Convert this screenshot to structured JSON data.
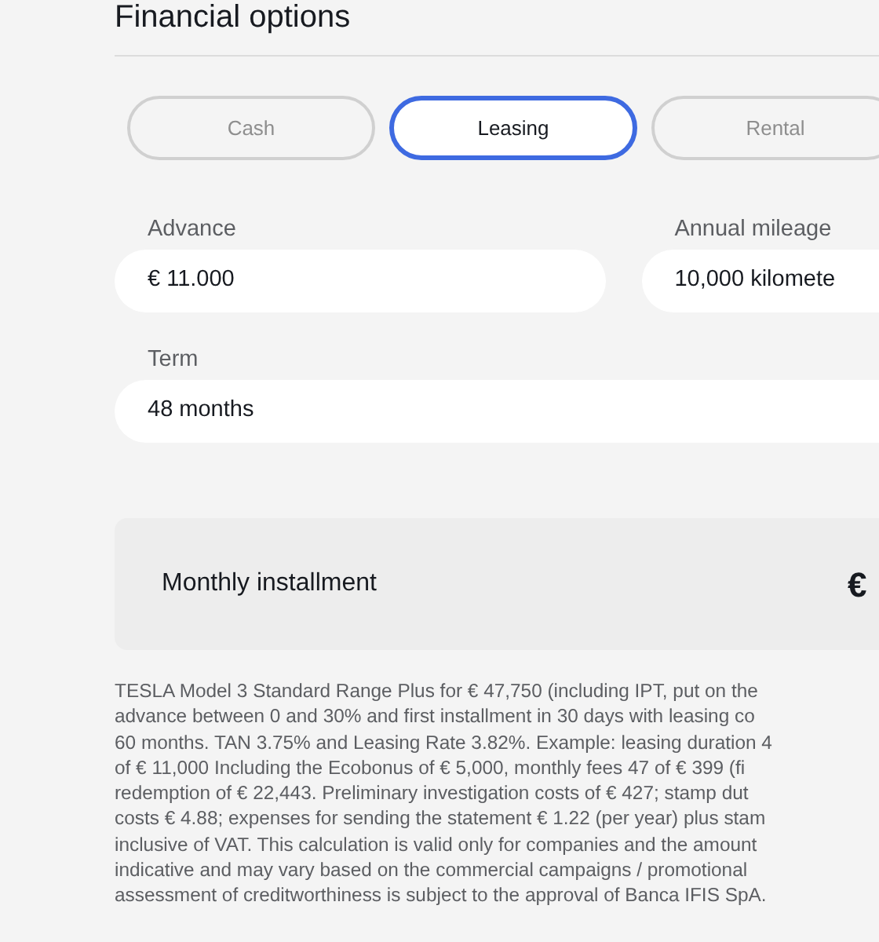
{
  "section": {
    "title": "Financial options"
  },
  "tabs": [
    {
      "label": "Cash",
      "selected": false
    },
    {
      "label": "Leasing",
      "selected": true
    },
    {
      "label": "Rental",
      "selected": false
    }
  ],
  "fields": [
    {
      "label": "Advance",
      "value": "€ 11.000"
    },
    {
      "label": "Annual mileage",
      "value": "10,000 kilomete"
    },
    {
      "label": "Term",
      "value": "48 months"
    }
  ],
  "summary": {
    "label": "Monthly installment",
    "value": "€"
  },
  "disclaimer_lines": [
    "TESLA Model 3 Standard Range Plus for € 47,750 (including IPT, put on the",
    "advance between 0 and 30% and first installment in 30 days with leasing co",
    "60 months. TAN 3.75% and Leasing Rate 3.82%. Example: leasing duration 4",
    "of € 11,000 Including the Ecobonus of € 5,000, monthly fees 47 of € 399 (fi",
    "redemption of € 22,443. Preliminary investigation costs of € 427; stamp dut",
    "costs € 4.88; expenses for sending the statement € 1.22 (per year) plus stam",
    "inclusive of VAT. This calculation is valid only for companies and the amount",
    "indicative and may vary based on the commercial campaigns / promotional",
    "assessment of creditworthiness is subject to the approval of Banca IFIS SpA."
  ]
}
